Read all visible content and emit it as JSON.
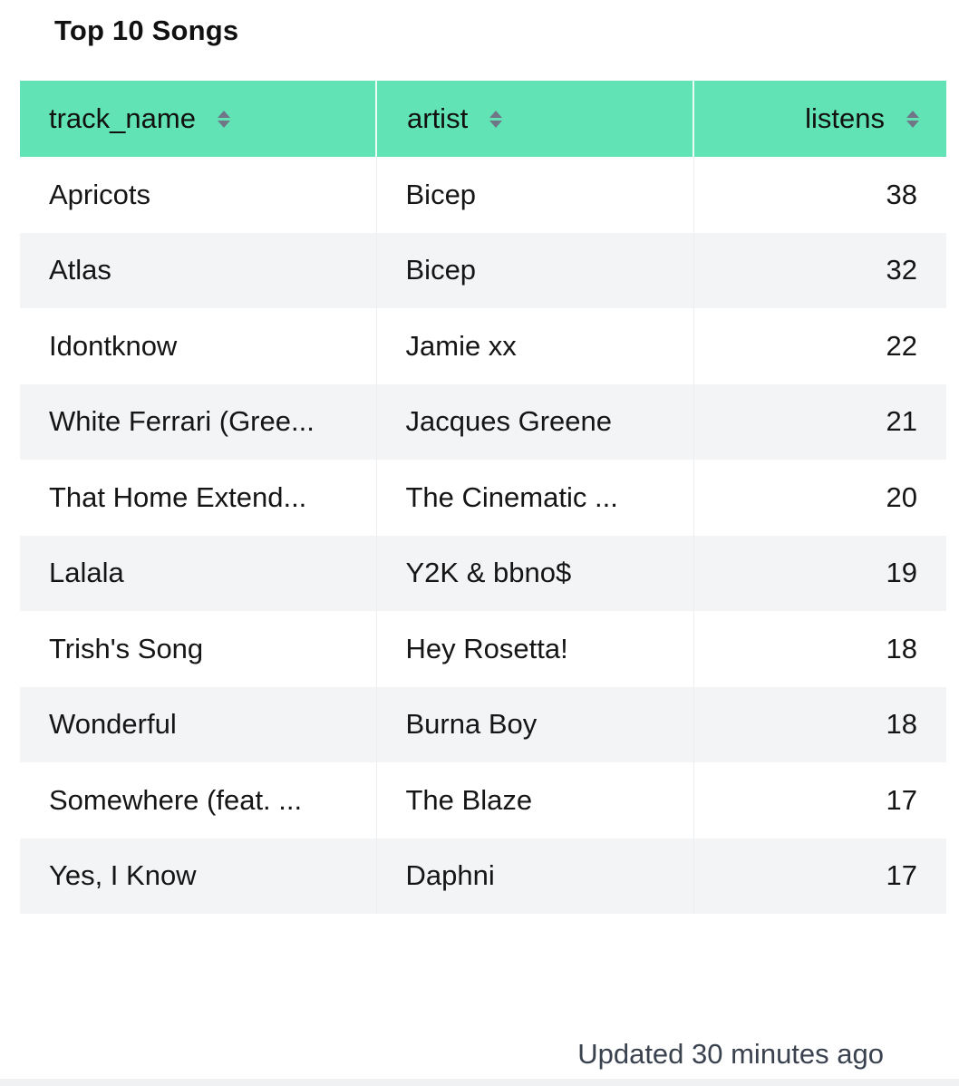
{
  "title": "Top 10 Songs",
  "table": {
    "columns": [
      {
        "label": "track_name",
        "sort_icon": "sort-icon"
      },
      {
        "label": "artist",
        "sort_icon": "sort-icon"
      },
      {
        "label": "listens",
        "sort_icon": "sort-icon"
      }
    ],
    "rows": [
      {
        "track_name": "Apricots",
        "artist": "Bicep",
        "listens": "38"
      },
      {
        "track_name": "Atlas",
        "artist": "Bicep",
        "listens": "32"
      },
      {
        "track_name": "Idontknow",
        "artist": "Jamie xx",
        "listens": "22"
      },
      {
        "track_name": "White Ferrari (Gree...",
        "artist": "Jacques Greene",
        "listens": "21"
      },
      {
        "track_name": "That Home Extend...",
        "artist": "The Cinematic ...",
        "listens": "20"
      },
      {
        "track_name": "Lalala",
        "artist": "Y2K & bbno$",
        "listens": "19"
      },
      {
        "track_name": "Trish's Song",
        "artist": "Hey Rosetta!",
        "listens": "18"
      },
      {
        "track_name": "Wonderful",
        "artist": "Burna Boy",
        "listens": "18"
      },
      {
        "track_name": "Somewhere (feat. ...",
        "artist": "The Blaze",
        "listens": "17"
      },
      {
        "track_name": "Yes, I Know",
        "artist": "Daphni",
        "listens": "17"
      }
    ]
  },
  "footer": {
    "updated": "Updated 30 minutes ago"
  },
  "colors": {
    "header_bg": "#62e3b6",
    "alt_row_bg": "#f3f4f6"
  }
}
